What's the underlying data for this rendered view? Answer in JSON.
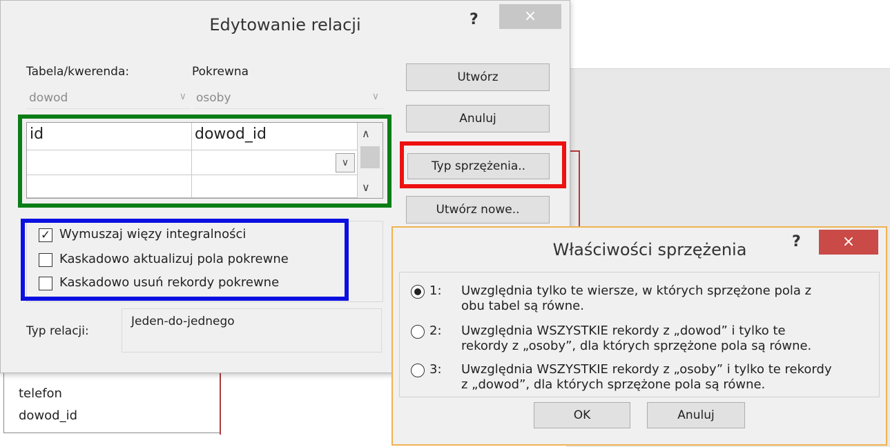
{
  "background": {
    "table_fields": [
      "telefon",
      "dowod_id"
    ]
  },
  "edit_relations": {
    "title": "Edytowanie relacji",
    "help": "?",
    "close": "×",
    "table_label": "Tabela/kwerenda:",
    "related_label": "Pokrewna",
    "table_value": "dowod",
    "related_value": "osoby",
    "rows": [
      {
        "left": "id",
        "right": "dowod_id"
      },
      {
        "left": "",
        "right": ""
      },
      {
        "left": "",
        "right": ""
      }
    ],
    "buttons": {
      "create": "Utwórz",
      "cancel": "Anuluj",
      "join_type": "Typ sprzężenia..",
      "create_new": "Utwórz nowe.."
    },
    "checkboxes": [
      {
        "label": "Wymuszaj więzy integralności",
        "checked": true
      },
      {
        "label": "Kaskadowo aktualizuj pola pokrewne",
        "checked": false
      },
      {
        "label": "Kaskadowo usuń rekordy pokrewne",
        "checked": false
      }
    ],
    "relation_type_label": "Typ relacji:",
    "relation_type_value": "Jeden-do-jednego"
  },
  "join_properties": {
    "title": "Właściwości sprzężenia",
    "help": "?",
    "close": "×",
    "options": [
      {
        "num": "1:",
        "line1": "Uwzględnia tylko te wiersze, w których sprzężone pola z",
        "line2": "obu tabel są równe.",
        "selected": true
      },
      {
        "num": "2:",
        "line1": "Uwzględnia WSZYSTKIE rekordy z „dowod” i tylko te",
        "line2": "rekordy z „osoby”, dla których sprzężone pola są równe.",
        "selected": false
      },
      {
        "num": "3:",
        "line1": "Uwzględnia WSZYSTKIE rekordy z „osoby” i tylko te rekordy",
        "line2": "z „dowod”, dla których sprzężone pola są równe.",
        "selected": false
      }
    ],
    "ok": "OK",
    "cancel": "Anuluj"
  },
  "colors": {
    "highlight_green": "#0a7d16",
    "highlight_red": "#ee1111",
    "highlight_blue": "#0b10e0",
    "join_dialog_border": "#f0b24f",
    "close_active": "#c94a47"
  }
}
